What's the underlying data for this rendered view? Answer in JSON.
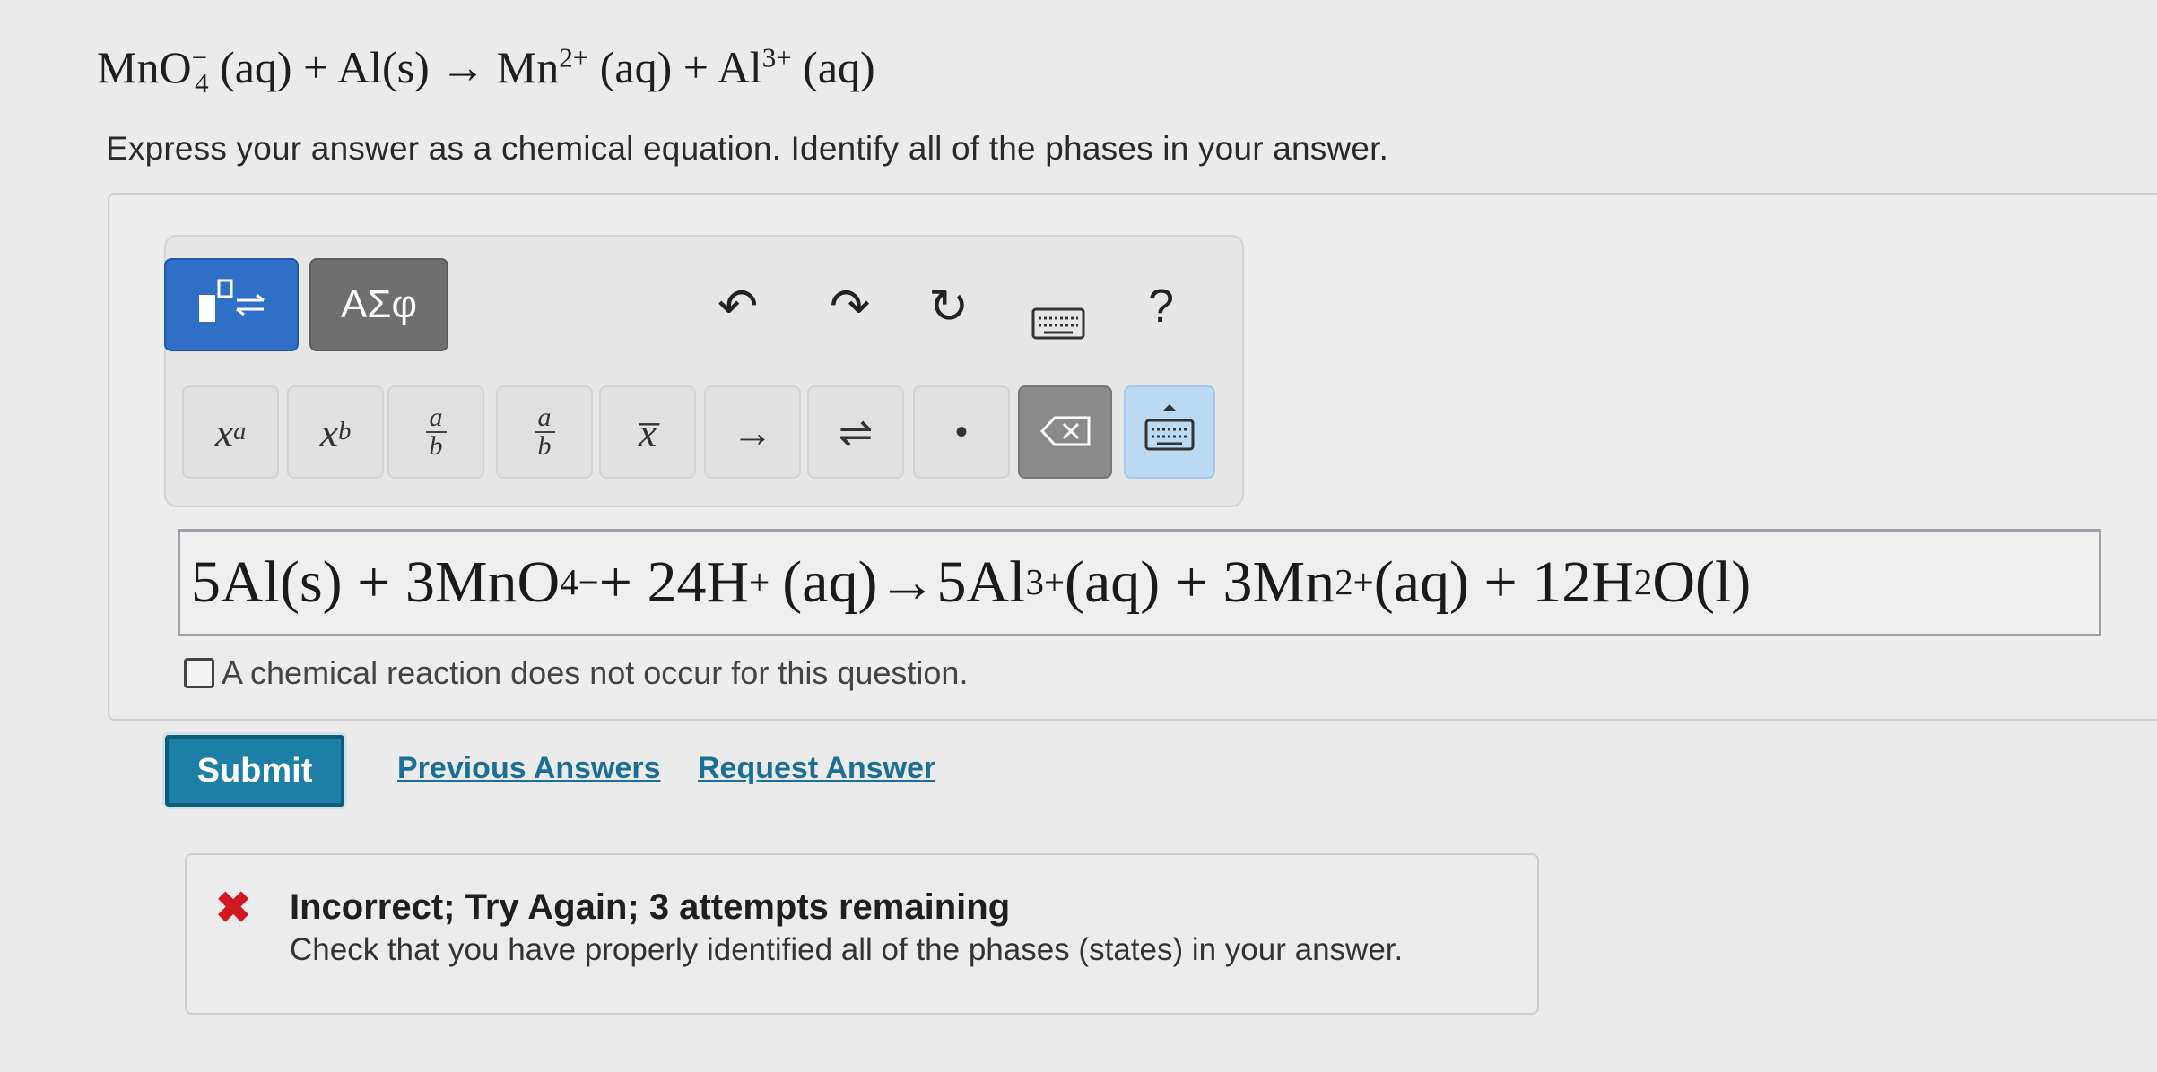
{
  "question": {
    "reactant1": "MnO",
    "reactant1_sub": "4",
    "reactant1_sup": "−",
    "reactant1_phase": "(aq)",
    "plus1": "+",
    "reactant2": "Al(s)",
    "arrow": "→",
    "product1": "Mn",
    "product1_sup": "2+",
    "product1_phase": "(aq)",
    "plus2": "+",
    "product2": "Al",
    "product2_sup": "3+",
    "product2_phase": "(aq)"
  },
  "instructions": "Express your answer as a chemical equation. Identify all of the phases in your answer.",
  "toolbar": {
    "templates_icon": "templates-icon",
    "greek_label": "ΑΣφ",
    "undo_glyph": "↶",
    "redo_glyph": "↷",
    "reset_glyph": "↻",
    "keyboard_glyph": "⌨",
    "help_label": "?",
    "keys": {
      "sup_base": "x",
      "sup_exp": "a",
      "sub_base": "x",
      "sub_idx": "b",
      "frac_small_num": "a",
      "frac_small_den": "b",
      "frac_num": "a",
      "frac_den": "b",
      "bar": "x̅",
      "arrow": "→",
      "equil": "⇌",
      "dot": "•",
      "backspace": "⌫",
      "keyboard": "⌨"
    }
  },
  "answer": {
    "t1": "5Al(s) + 3MnO",
    "t1_sub": "4",
    "t1_sup": "−",
    "t2": " + 24H",
    "t2_sup": "+",
    "t3": "(aq)→5Al",
    "t3_sup": "3+",
    "t4": "(aq) + 3Mn",
    "t4_sup": "2+",
    "t5": "(aq) + 12H",
    "t5_sub": "2",
    "t6": "O(l)"
  },
  "no_reaction_label": "A chemical reaction does not occur for this question.",
  "actions": {
    "submit_label": "Submit",
    "previous_answers_label": "Previous Answers",
    "request_answer_label": "Request Answer"
  },
  "feedback": {
    "icon": "✖",
    "title": "Incorrect; Try Again; 3 attempts remaining",
    "detail": "Check that you have properly identified all of the phases (states) in your answer."
  },
  "colors": {
    "accent": "#1e7fa6",
    "link": "#1b6e95",
    "error": "#d0181e",
    "templates_button": "#2f6fc6"
  }
}
